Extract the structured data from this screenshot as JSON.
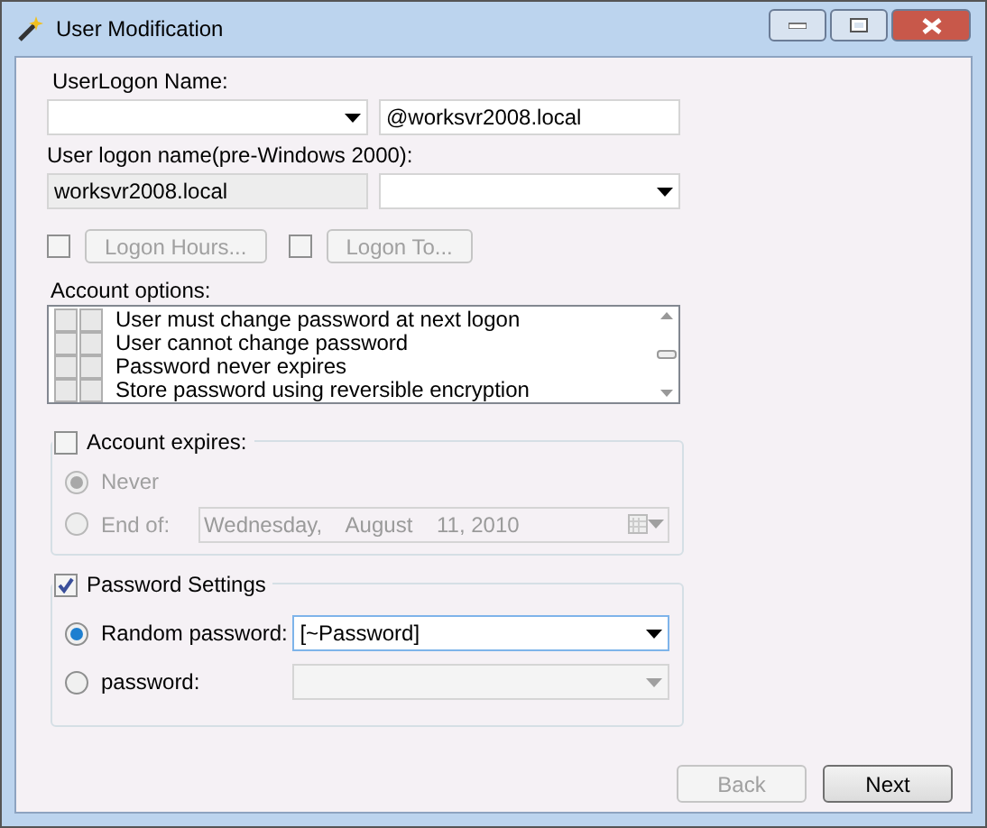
{
  "window": {
    "title": "User Modification"
  },
  "logon_name": {
    "label": "UserLogon Name:",
    "domain": "@worksvr2008.local"
  },
  "pre_2000": {
    "label": "User logon name(pre-Windows 2000):",
    "domain": "worksvr2008.local"
  },
  "logon_buttons": [
    {
      "label": "Logon Hours...",
      "checked": false,
      "disabled": true
    },
    {
      "label": "Logon To...",
      "checked": false,
      "disabled": true
    }
  ],
  "account_options": {
    "label": "Account options:",
    "items": [
      {
        "label": "User must change password at next logon",
        "checked": false,
        "checked_2": false
      },
      {
        "label": "User cannot change password",
        "checked": false,
        "checked_2": false
      },
      {
        "label": "Password never expires",
        "checked": false,
        "checked_2": false
      },
      {
        "label": "Store password using reversible encryption",
        "checked": false,
        "checked_2": false
      }
    ]
  },
  "account_expires": {
    "label": "Account expires:",
    "checked": false,
    "options": [
      {
        "label": "Never",
        "selected": true
      },
      {
        "label": "End of:",
        "selected": false,
        "date": "Wednesday,    August    11, 2010"
      }
    ]
  },
  "password_settings": {
    "label": "Password Settings",
    "checked": true,
    "options": [
      {
        "label": "Random password:",
        "selected": true,
        "value": "[~Password]"
      },
      {
        "label": "password:",
        "selected": false
      }
    ]
  },
  "buttons": [
    {
      "label": "Back",
      "disabled": true
    },
    {
      "label": "Next",
      "disabled": false
    }
  ]
}
